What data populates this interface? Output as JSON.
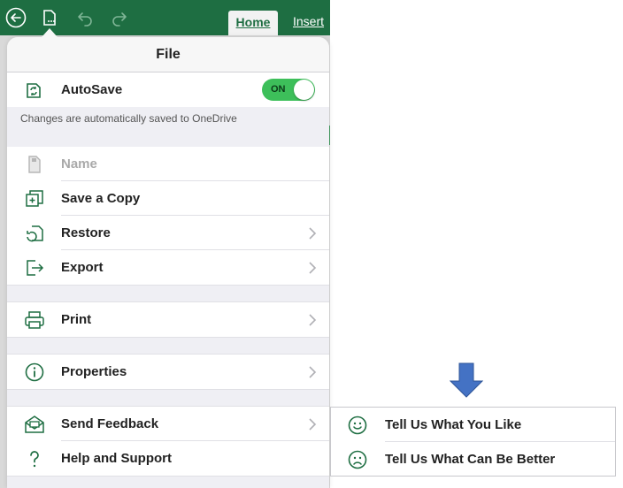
{
  "toolbar": {
    "tabs": [
      {
        "label": "Home"
      },
      {
        "label": "Insert"
      }
    ]
  },
  "file_menu": {
    "title": "File",
    "autosave": {
      "label": "AutoSave",
      "toggle_text": "ON",
      "note": "Changes are automatically saved to OneDrive"
    },
    "items": [
      {
        "label": "Name",
        "icon": "document-icon",
        "disabled": true
      },
      {
        "label": "Save a Copy",
        "icon": "save-copy-icon"
      },
      {
        "label": "Restore",
        "icon": "restore-icon"
      },
      {
        "label": "Export",
        "icon": "export-icon"
      },
      {
        "label": "Print",
        "icon": "printer-icon"
      },
      {
        "label": "Properties",
        "icon": "info-icon"
      },
      {
        "label": "Send Feedback",
        "icon": "feedback-envelope-icon"
      },
      {
        "label": "Help and Support",
        "icon": "question-mark-icon"
      }
    ]
  },
  "feedback_submenu": {
    "items": [
      {
        "label": "Tell Us What You Like",
        "icon": "smile-icon"
      },
      {
        "label": "Tell Us What Can Be Better",
        "icon": "frown-icon"
      }
    ]
  },
  "colors": {
    "app_green": "#1e6e42",
    "toggle_on": "#3dbf5a",
    "icon_green": "#1e6e42",
    "arrow_blue": "#4472c4"
  }
}
